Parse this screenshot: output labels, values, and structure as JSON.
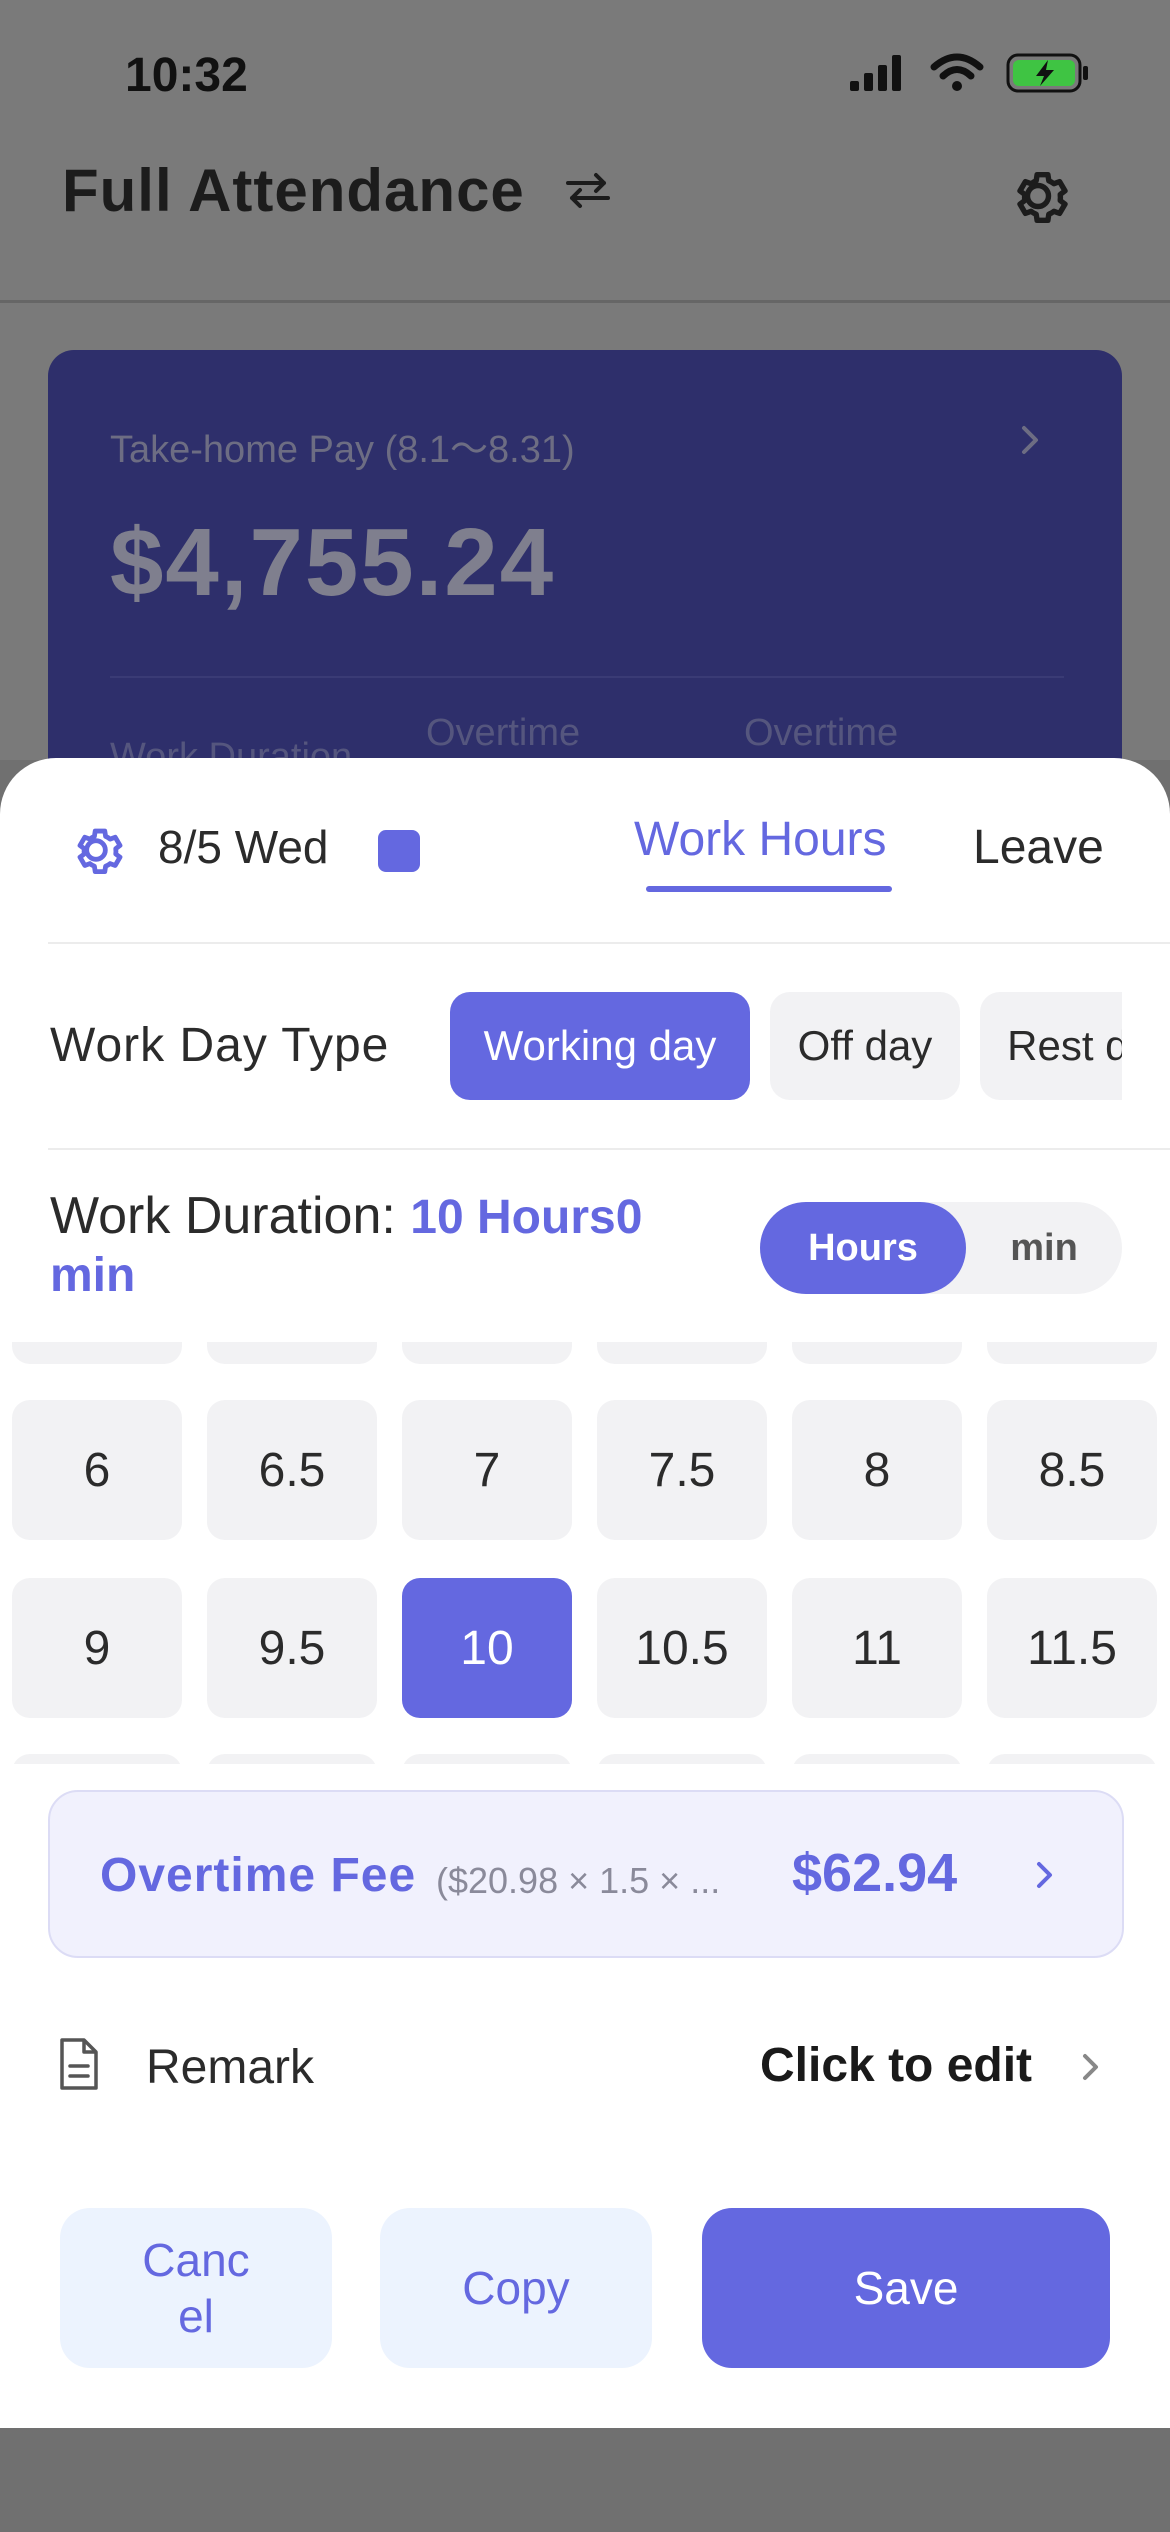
{
  "status_bar": {
    "time": "10:32"
  },
  "header": {
    "title": "Full Attendance"
  },
  "pay_card": {
    "label": "Take-home Pay (8.1～8.31)",
    "amount": "$4,755.24",
    "stat_1": "Work Duration",
    "stat_2": "Overtime",
    "stat_3": "Overtime"
  },
  "sheet": {
    "date": "8/5 Wed",
    "tabs": {
      "work_hours": "Work Hours",
      "leave": "Leave"
    },
    "work_day_type": {
      "label": "Work Day Type",
      "options": [
        "Working day",
        "Off day",
        "Rest day"
      ],
      "selected": "Working day"
    },
    "duration": {
      "label": "Work Duration:",
      "value": "10 Hours0 min",
      "unit_hours": "Hours",
      "unit_min": "min"
    },
    "hours_grid": {
      "row_1": [
        "6",
        "6.5",
        "7",
        "7.5",
        "8",
        "8.5"
      ],
      "row_2": [
        "9",
        "9.5",
        "10",
        "10.5",
        "11",
        "11.5"
      ],
      "selected": "10"
    },
    "overtime": {
      "label": "Overtime Fee",
      "formula": "($20.98 × 1.5 × ...",
      "amount": "$62.94"
    },
    "remark": {
      "label": "Remark",
      "action": "Click to edit"
    },
    "buttons": {
      "cancel": "Cancel",
      "copy": "Copy",
      "save": "Save"
    }
  },
  "colors": {
    "accent": "#6468e0",
    "card": "#2e2f6b",
    "chip_bg": "#f2f2f4"
  }
}
